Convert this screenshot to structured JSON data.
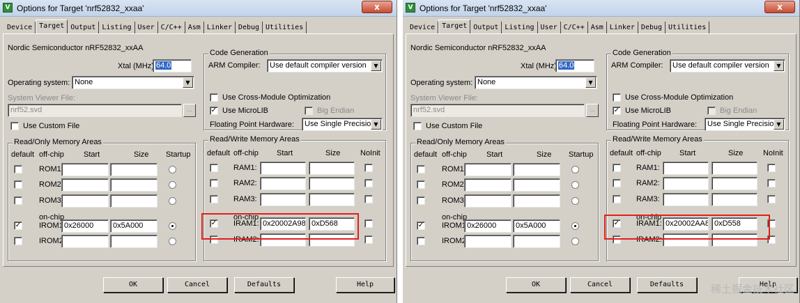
{
  "left": {
    "title": "Options for Target 'nrf52832_xxaa'",
    "close_label": "x",
    "tabs": [
      "Device",
      "Target",
      "Output",
      "Listing",
      "User",
      "C/C++",
      "Asm",
      "Linker",
      "Debug",
      "Utilities"
    ],
    "active_tab": "Target",
    "device_name": "Nordic Semiconductor nRF52832_xxAA",
    "xtal_label": "Xtal (MHz):",
    "xtal_value": "64.0",
    "os_label": "Operating system:",
    "os_value": "None",
    "svf_label": "System Viewer File:",
    "svf_value": "nrf52.svd",
    "browse_label": "...",
    "custom_file_label": "Use Custom File",
    "codegen": {
      "legend": "Code Generation",
      "compiler_label": "ARM Compiler:",
      "compiler_value": "Use default compiler version",
      "cross_module_label": "Use Cross-Module Optimization",
      "cross_module_checked": false,
      "microlib_label": "Use MicroLIB",
      "microlib_checked": true,
      "big_endian_label": "Big Endian",
      "fpu_label": "Floating Point Hardware:",
      "fpu_value": "Use Single Precision"
    },
    "ro": {
      "legend": "Read/Only Memory Areas",
      "headers": {
        "default": "default",
        "offchip": "off-chip",
        "start": "Start",
        "size": "Size",
        "startup": "Startup"
      },
      "onchip_label": "on-chip",
      "rows": [
        {
          "label": "ROM1:",
          "start": "",
          "size": "",
          "checked": false,
          "startup": false
        },
        {
          "label": "ROM2:",
          "start": "",
          "size": "",
          "checked": false,
          "startup": false
        },
        {
          "label": "ROM3:",
          "start": "",
          "size": "",
          "checked": false,
          "startup": false
        },
        {
          "label": "IROM1:",
          "start": "0x26000",
          "size": "0x5A000",
          "checked": true,
          "startup": true
        },
        {
          "label": "IROM2:",
          "start": "",
          "size": "",
          "checked": false,
          "startup": false
        }
      ]
    },
    "rw": {
      "legend": "Read/Write Memory Areas",
      "headers": {
        "default": "default",
        "offchip": "off-chip",
        "start": "Start",
        "size": "Size",
        "noinit": "NoInit"
      },
      "onchip_label": "on-chip",
      "rows": [
        {
          "label": "RAM1:",
          "start": "",
          "size": "",
          "checked": false
        },
        {
          "label": "RAM2:",
          "start": "",
          "size": "",
          "checked": false
        },
        {
          "label": "RAM3:",
          "start": "",
          "size": "",
          "checked": false
        },
        {
          "label": "IRAM1:",
          "start": "0x20002A98",
          "size": "0xD568",
          "checked": true
        },
        {
          "label": "IRAM2:",
          "start": "",
          "size": "",
          "checked": false
        }
      ]
    },
    "buttons": {
      "ok": "OK",
      "cancel": "Cancel",
      "defaults": "Defaults",
      "help": "Help"
    }
  },
  "right": {
    "title": "Options for Target 'nrf52832_xxaa'",
    "close_label": "x",
    "tabs": [
      "Device",
      "Target",
      "Output",
      "Listing",
      "User",
      "C/C++",
      "Asm",
      "Linker",
      "Debug",
      "Utilities"
    ],
    "active_tab": "Target",
    "device_name": "Nordic Semiconductor nRF52832_xxAA",
    "xtal_label": "Xtal (MHz):",
    "xtal_value": "64.0",
    "os_label": "Operating system:",
    "os_value": "None",
    "svf_label": "System Viewer File:",
    "svf_value": "nrf52.svd",
    "browse_label": "...",
    "custom_file_label": "Use Custom File",
    "codegen": {
      "legend": "Code Generation",
      "compiler_label": "ARM Compiler:",
      "compiler_value": "Use default compiler version",
      "cross_module_label": "Use Cross-Module Optimization",
      "cross_module_checked": false,
      "microlib_label": "Use MicroLIB",
      "microlib_checked": true,
      "big_endian_label": "Big Endian",
      "fpu_label": "Floating Point Hardware:",
      "fpu_value": "Use Single Precision"
    },
    "ro": {
      "legend": "Read/Only Memory Areas",
      "headers": {
        "default": "default",
        "offchip": "off-chip",
        "start": "Start",
        "size": "Size",
        "startup": "Startup"
      },
      "onchip_label": "on-chip",
      "rows": [
        {
          "label": "ROM1:",
          "start": "",
          "size": "",
          "checked": false,
          "startup": false
        },
        {
          "label": "ROM2:",
          "start": "",
          "size": "",
          "checked": false,
          "startup": false
        },
        {
          "label": "ROM3:",
          "start": "",
          "size": "",
          "checked": false,
          "startup": false
        },
        {
          "label": "IROM1:",
          "start": "0x26000",
          "size": "0x5A000",
          "checked": true,
          "startup": true
        },
        {
          "label": "IROM2:",
          "start": "",
          "size": "",
          "checked": false,
          "startup": false
        }
      ]
    },
    "rw": {
      "legend": "Read/Write Memory Areas",
      "headers": {
        "default": "default",
        "offchip": "off-chip",
        "start": "Start",
        "size": "Size",
        "noinit": "NoInit"
      },
      "onchip_label": "on-chip",
      "rows": [
        {
          "label": "RAM1:",
          "start": "",
          "size": "",
          "checked": false
        },
        {
          "label": "RAM2:",
          "start": "",
          "size": "",
          "checked": false
        },
        {
          "label": "RAM3:",
          "start": "",
          "size": "",
          "checked": false
        },
        {
          "label": "IRAM1:",
          "start": "0x20002AA8",
          "size": "0xD558",
          "checked": true
        },
        {
          "label": "IRAM2:",
          "start": "",
          "size": "",
          "checked": false
        }
      ]
    },
    "buttons": {
      "ok": "OK",
      "cancel": "Cancel",
      "defaults": "Defaults",
      "help": "Help"
    }
  },
  "watermark": "稀土掘金技术社区"
}
